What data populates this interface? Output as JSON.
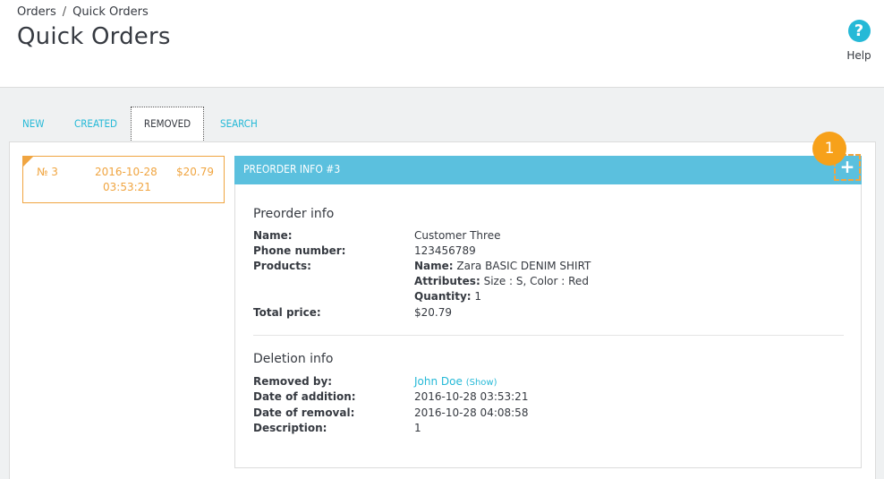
{
  "breadcrumb": {
    "parent": "Orders",
    "separator": "/",
    "current": "Quick Orders"
  },
  "page_title": "Quick Orders",
  "help": {
    "icon": "?",
    "label": "Help"
  },
  "tabs": [
    {
      "label": "NEW",
      "active": false
    },
    {
      "label": "CREATED",
      "active": false
    },
    {
      "label": "REMOVED",
      "active": true
    },
    {
      "label": "SEARCH",
      "active": false
    }
  ],
  "order_card": {
    "number": "№ 3",
    "date": "2016-10-28",
    "time": "03:53:21",
    "price": "$20.79"
  },
  "info": {
    "title": "PREORDER INFO #3",
    "plus_label": "+",
    "badge": "1",
    "preorder": {
      "title": "Preorder info",
      "name_label": "Name:",
      "name_value": "Customer Three",
      "phone_label": "Phone number:",
      "phone_value": "123456789",
      "products_label": "Products:",
      "product_name_key": "Name:",
      "product_name_value": "Zara BASIC DENIM SHIRT",
      "attributes_key": "Attributes:",
      "attributes_value": "Size : S, Color : Red",
      "quantity_key": "Quantity:",
      "quantity_value": "1",
      "total_label": "Total price:",
      "total_value": "$20.79"
    },
    "deletion": {
      "title": "Deletion info",
      "removed_by_label": "Removed by:",
      "removed_by_value": "John Doe",
      "show_label": "(Show)",
      "date_addition_label": "Date of addition:",
      "date_addition_value": "2016-10-28 03:53:21",
      "date_removal_label": "Date of removal:",
      "date_removal_value": "2016-10-28 04:08:58",
      "description_label": "Description:",
      "description_value": "1"
    }
  },
  "colors": {
    "accent": "#25b9d7",
    "header_bar": "#5bc0de",
    "highlight": "#f0a541",
    "badge": "#f7a11a"
  }
}
